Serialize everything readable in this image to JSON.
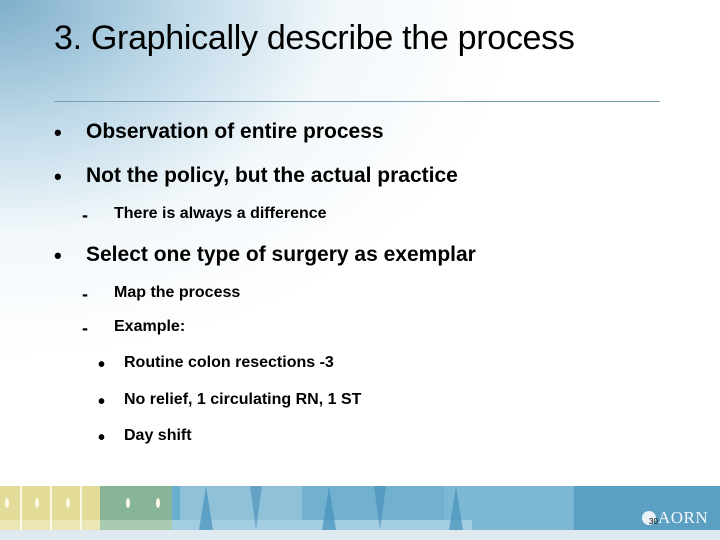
{
  "slide": {
    "title": "3. Graphically describe the process",
    "bullets": [
      {
        "level": 1,
        "marker": "•",
        "text": "Observation of entire process"
      },
      {
        "level": 1,
        "marker": "•",
        "text": "Not the policy, but the actual practice"
      },
      {
        "level": 2,
        "marker": "-",
        "text": "There is always a difference"
      },
      {
        "level": 1,
        "marker": "•",
        "text": "Select one type of surgery as exemplar"
      },
      {
        "level": 2,
        "marker": "-",
        "text": "Map the process"
      },
      {
        "level": 2,
        "marker": "-",
        "text": "Example:"
      },
      {
        "level": 3,
        "marker": "•",
        "text": "Routine colon resections -3"
      },
      {
        "level": 3,
        "marker": "•",
        "text": "No relief, 1 circulating RN, 1 ST"
      },
      {
        "level": 3,
        "marker": "•",
        "text": "Day shift"
      }
    ]
  },
  "footer": {
    "logo_text": "AORN",
    "logo_icon": "aorn-logo-icon",
    "page_number": "30"
  },
  "colors": {
    "title_rule": "#7a9fb5",
    "band_yellow": "#e2dc98",
    "band_green": "#88b49a",
    "band_blue": "#8fc2d8",
    "band_blue_dark": "#5b9fc3"
  }
}
